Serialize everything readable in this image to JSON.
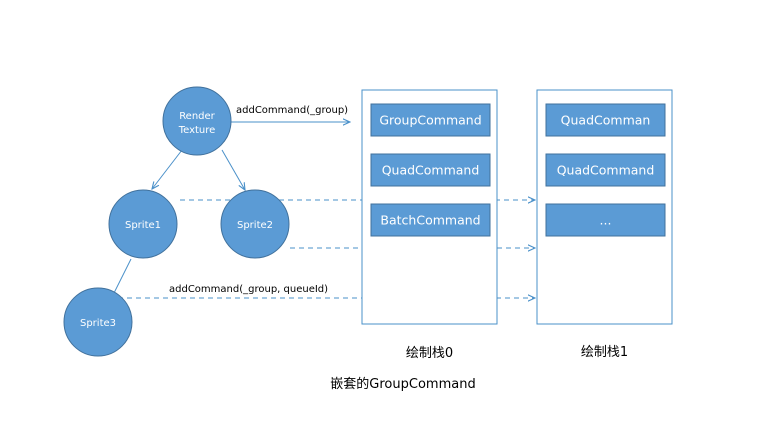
{
  "colors": {
    "node_fill": "#5b9bd5",
    "node_stroke": "#41719c",
    "stack_border": "#4a90c9",
    "arrow": "#4a90c9",
    "text_dark": "#000000",
    "text_light": "#ffffff"
  },
  "nodes": {
    "render_texture": {
      "line1": "Render",
      "line2": "Texture"
    },
    "sprite1": "Sprite1",
    "sprite2": "Sprite2",
    "sprite3": "Sprite3"
  },
  "edges": {
    "add_command_group": "addCommand(_group)",
    "add_command_group_queue": "addCommand(_group, queueId)"
  },
  "stacks": [
    {
      "caption": "绘制栈0",
      "commands": [
        "GroupCommand",
        "QuadCommand",
        "BatchCommand"
      ]
    },
    {
      "caption": "绘制栈1",
      "commands": [
        "QuadComman",
        "QuadCommand",
        "..."
      ]
    }
  ],
  "footer_caption": "嵌套的GroupCommand"
}
